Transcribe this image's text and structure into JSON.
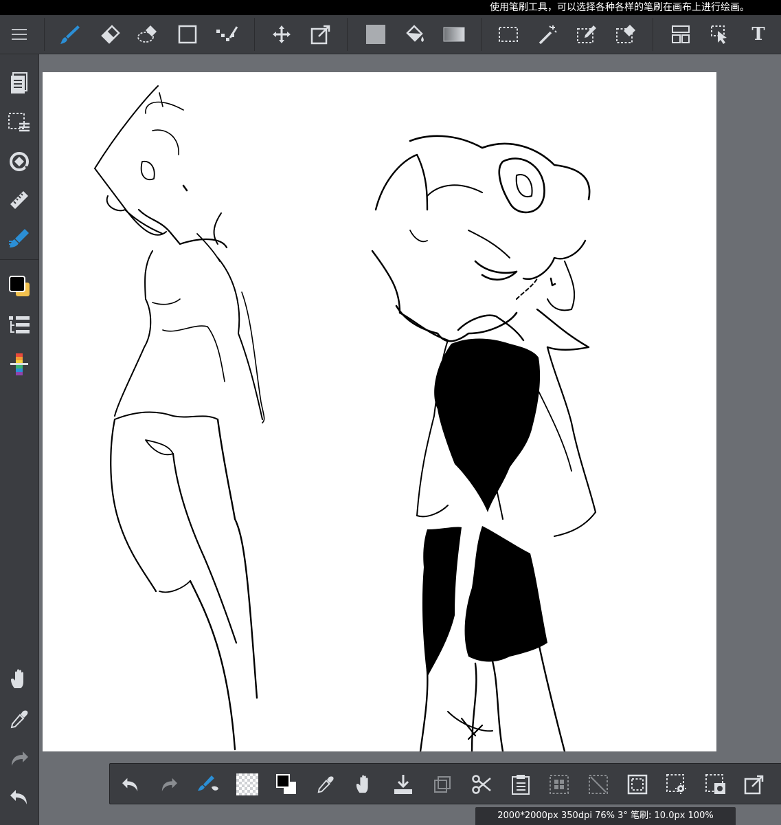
{
  "tooltip": {
    "text": "使用笔刷工具，可以选择各种各样的笔刷在画布上进行绘画。"
  },
  "colors": {
    "ui_bg": "#3b3d41",
    "outer_bg": "#6b6e73",
    "accent_blue": "#2b8fd6",
    "canvas": "#ffffff",
    "main_color": "#000000",
    "sub_color": "#f2c14e"
  },
  "toolbar": {
    "menu": "hamburger-menu-icon",
    "tools": [
      "brush-icon",
      "eraser-icon",
      "lasso-eraser-icon",
      "rectangle-icon",
      "dot-line-icon",
      "move-icon",
      "transform-icon",
      "fill-color-icon",
      "bucket-icon",
      "gradient-icon",
      "select-rect-icon",
      "magic-wand-icon",
      "select-pen-icon",
      "select-eraser-icon",
      "panel-layout-icon",
      "object-select-icon"
    ],
    "text_tool": "T"
  },
  "sidebar": {
    "tools": [
      "pages-icon",
      "layer-select-icon",
      "rotate-icon",
      "ruler-icon",
      "snap-pen-icon",
      "color-swatch-icon",
      "layers-icon",
      "color-palette-icon",
      "hand-icon",
      "eyedropper-icon",
      "redo-icon",
      "undo-icon"
    ]
  },
  "bottombar": {
    "tools": [
      "undo-icon",
      "redo-icon",
      "brush-settings-icon",
      "transparent-icon",
      "swap-colors-icon",
      "eyedropper-icon",
      "hand-icon",
      "save-icon",
      "copy-layer-icon",
      "cut-icon",
      "paste-icon",
      "select-all-icon",
      "deselect-icon",
      "invert-selection-icon",
      "selection-settings-icon",
      "snapshot-icon",
      "export-icon"
    ]
  },
  "status": {
    "text": "2000*2000px 350dpi 76% 3° 笔刷: 10.0px 100%"
  }
}
